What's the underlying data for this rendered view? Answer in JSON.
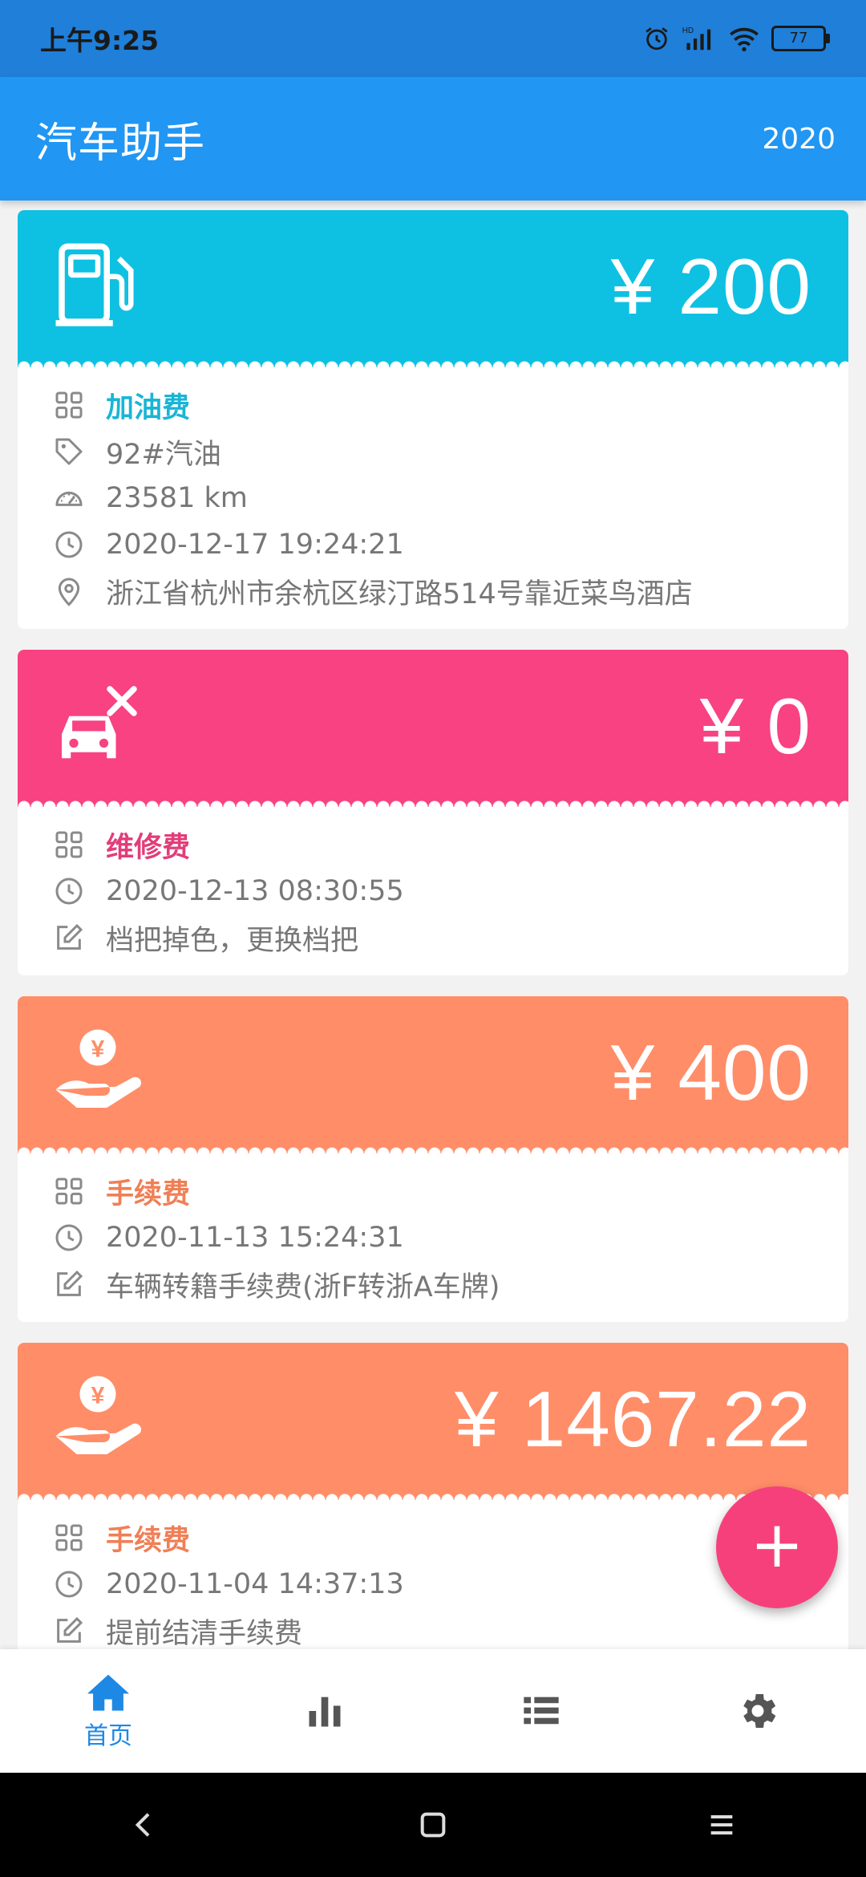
{
  "status_bar": {
    "time": "上午9:25",
    "battery": "77"
  },
  "app_bar": {
    "title": "汽车助手",
    "year": "2020"
  },
  "records": [
    {
      "amount": "¥ 200",
      "color": "#0ec1e2",
      "icon": "fuel-pump-icon",
      "category": "加油费",
      "category_color": "#19b5d6",
      "fuel_type": "92#汽油",
      "mileage": "23581 km",
      "datetime": "2020-12-17 19:24:21",
      "location": "浙江省杭州市余杭区绿汀路514号靠近菜鸟酒店"
    },
    {
      "amount": "¥ 0",
      "color": "#f84281",
      "icon": "car-repair-icon",
      "category": "维修费",
      "category_color": "#e23d79",
      "datetime": "2020-12-13 08:30:55",
      "note": "档把掉色，更换档把"
    },
    {
      "amount": "¥ 400",
      "color": "#ff8d68",
      "icon": "hand-yuan-icon",
      "category": "手续费",
      "category_color": "#f07f56",
      "datetime": "2020-11-13 15:24:31",
      "note": "车辆转籍手续费(浙F转浙A车牌)"
    },
    {
      "amount": "¥ 1467.22",
      "color": "#ff8d68",
      "icon": "hand-yuan-icon",
      "category": "手续费",
      "category_color": "#f07f56",
      "datetime": "2020-11-04 14:37:13",
      "note": "提前结清手续费"
    }
  ],
  "fab": {
    "label": "+"
  },
  "bottom_nav": {
    "items": [
      {
        "icon": "home-icon",
        "label": "首页",
        "active": true
      },
      {
        "icon": "bar-chart-icon",
        "label": "",
        "active": false
      },
      {
        "icon": "list-icon",
        "label": "",
        "active": false
      },
      {
        "icon": "gear-icon",
        "label": "",
        "active": false
      }
    ]
  }
}
